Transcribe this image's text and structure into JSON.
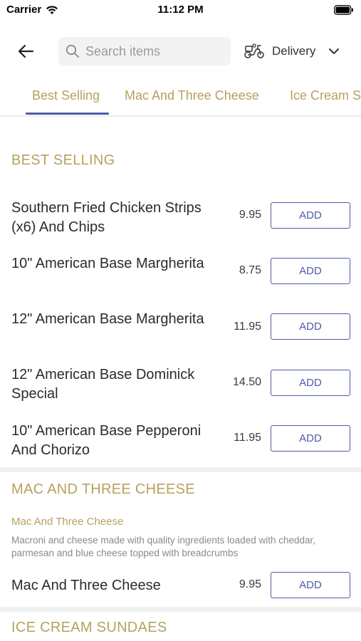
{
  "status_bar": {
    "carrier": "Carrier",
    "time": "11:12 PM"
  },
  "nav": {
    "search_placeholder": "Search items",
    "delivery_label": "Delivery"
  },
  "tabs": [
    {
      "label": "Best Selling",
      "active": true
    },
    {
      "label": "Mac And Three Cheese",
      "active": false
    },
    {
      "label": "Ice Cream Sundaes",
      "active": false
    }
  ],
  "add_label": "ADD",
  "sections": [
    {
      "title": "BEST SELLING",
      "items": [
        {
          "name": "Southern Fried Chicken Strips (x6) And Chips",
          "price": "9.95"
        },
        {
          "name": "10\" American Base Margherita",
          "price": "8.75"
        },
        {
          "name": "12\" American Base Margherita",
          "price": "11.95"
        },
        {
          "name": "12\" American Base Dominick Special",
          "price": "14.50"
        },
        {
          "name": "10\" American Base Pepperoni And Chorizo",
          "price": "11.95"
        }
      ]
    },
    {
      "title": "MAC AND THREE CHEESE",
      "subtitle": "Mac And Three Cheese",
      "description": "Macroni and cheese made with quality ingredients loaded with cheddar, parmesan and blue cheese topped with breadcrumbs",
      "items": [
        {
          "name": "Mac And Three Cheese",
          "price": "9.95"
        }
      ]
    },
    {
      "title": "ICE CREAM SUNDAES",
      "items": []
    }
  ],
  "colors": {
    "accent_gold": "#b5a25e",
    "accent_blue": "#4f5aa8"
  }
}
